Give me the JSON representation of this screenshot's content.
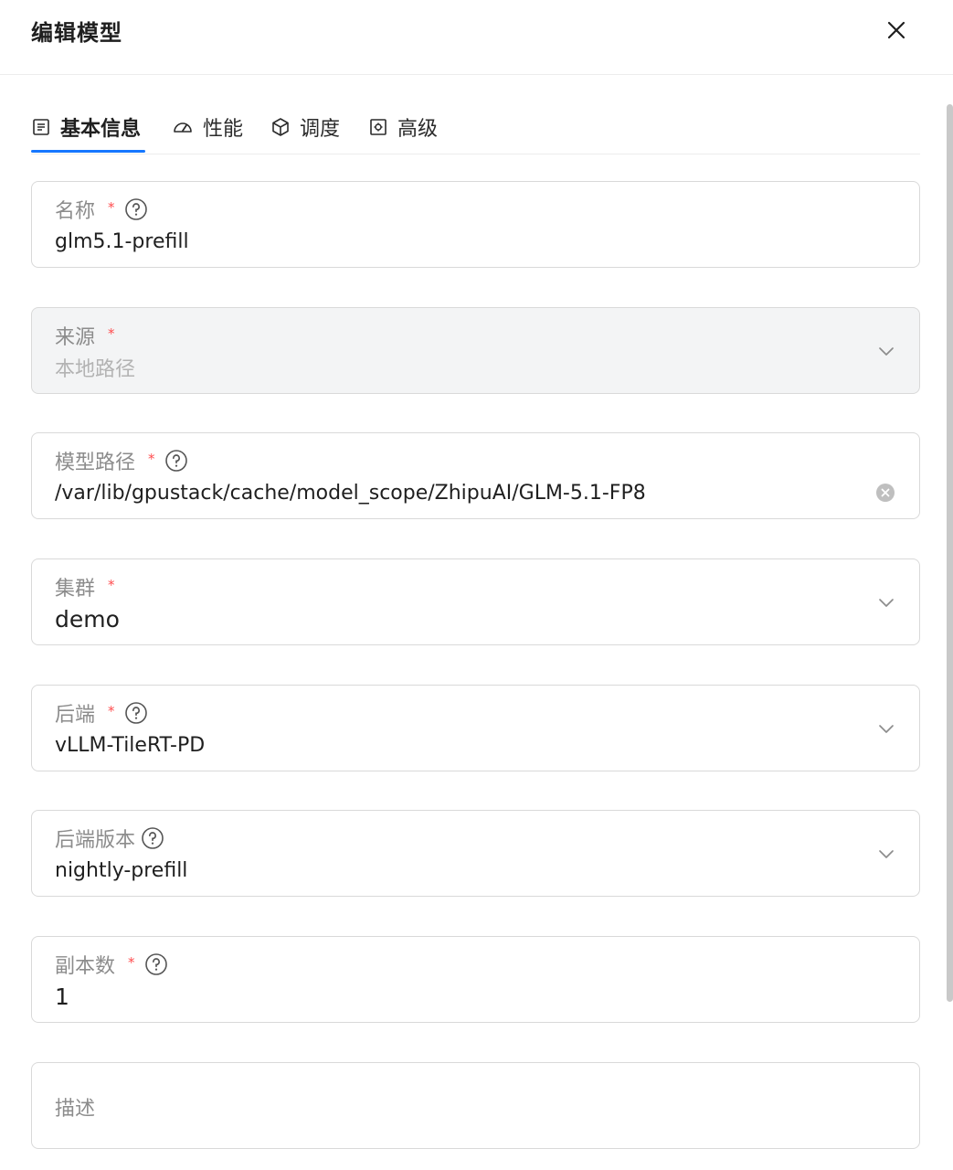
{
  "header": {
    "title": "编辑模型"
  },
  "tabs": [
    {
      "label": "基本信息",
      "icon": "document-icon",
      "active": true
    },
    {
      "label": "性能",
      "icon": "gauge-icon",
      "active": false
    },
    {
      "label": "调度",
      "icon": "cube-icon",
      "active": false
    },
    {
      "label": "高级",
      "icon": "gear-box-icon",
      "active": false
    }
  ],
  "form": {
    "name": {
      "label": "名称",
      "required": "*",
      "value": "glm5.1-prefill"
    },
    "source": {
      "label": "来源",
      "required": "*",
      "value": "本地路径"
    },
    "model_path": {
      "label": "模型路径",
      "required": "*",
      "value": "/var/lib/gpustack/cache/model_scope/ZhipuAI/GLM-5.1-FP8"
    },
    "cluster": {
      "label": "集群",
      "required": "*",
      "value": "demo"
    },
    "backend": {
      "label": "后端",
      "required": "*",
      "value": "vLLM-TileRT-PD"
    },
    "backend_version": {
      "label": "后端版本",
      "value": "nightly-prefill"
    },
    "replicas": {
      "label": "副本数",
      "required": "*",
      "value": "1"
    },
    "description": {
      "placeholder": "描述"
    }
  },
  "colors": {
    "accent": "#1677ff",
    "required": "#ff4d4f",
    "border": "#d9d9d9"
  }
}
